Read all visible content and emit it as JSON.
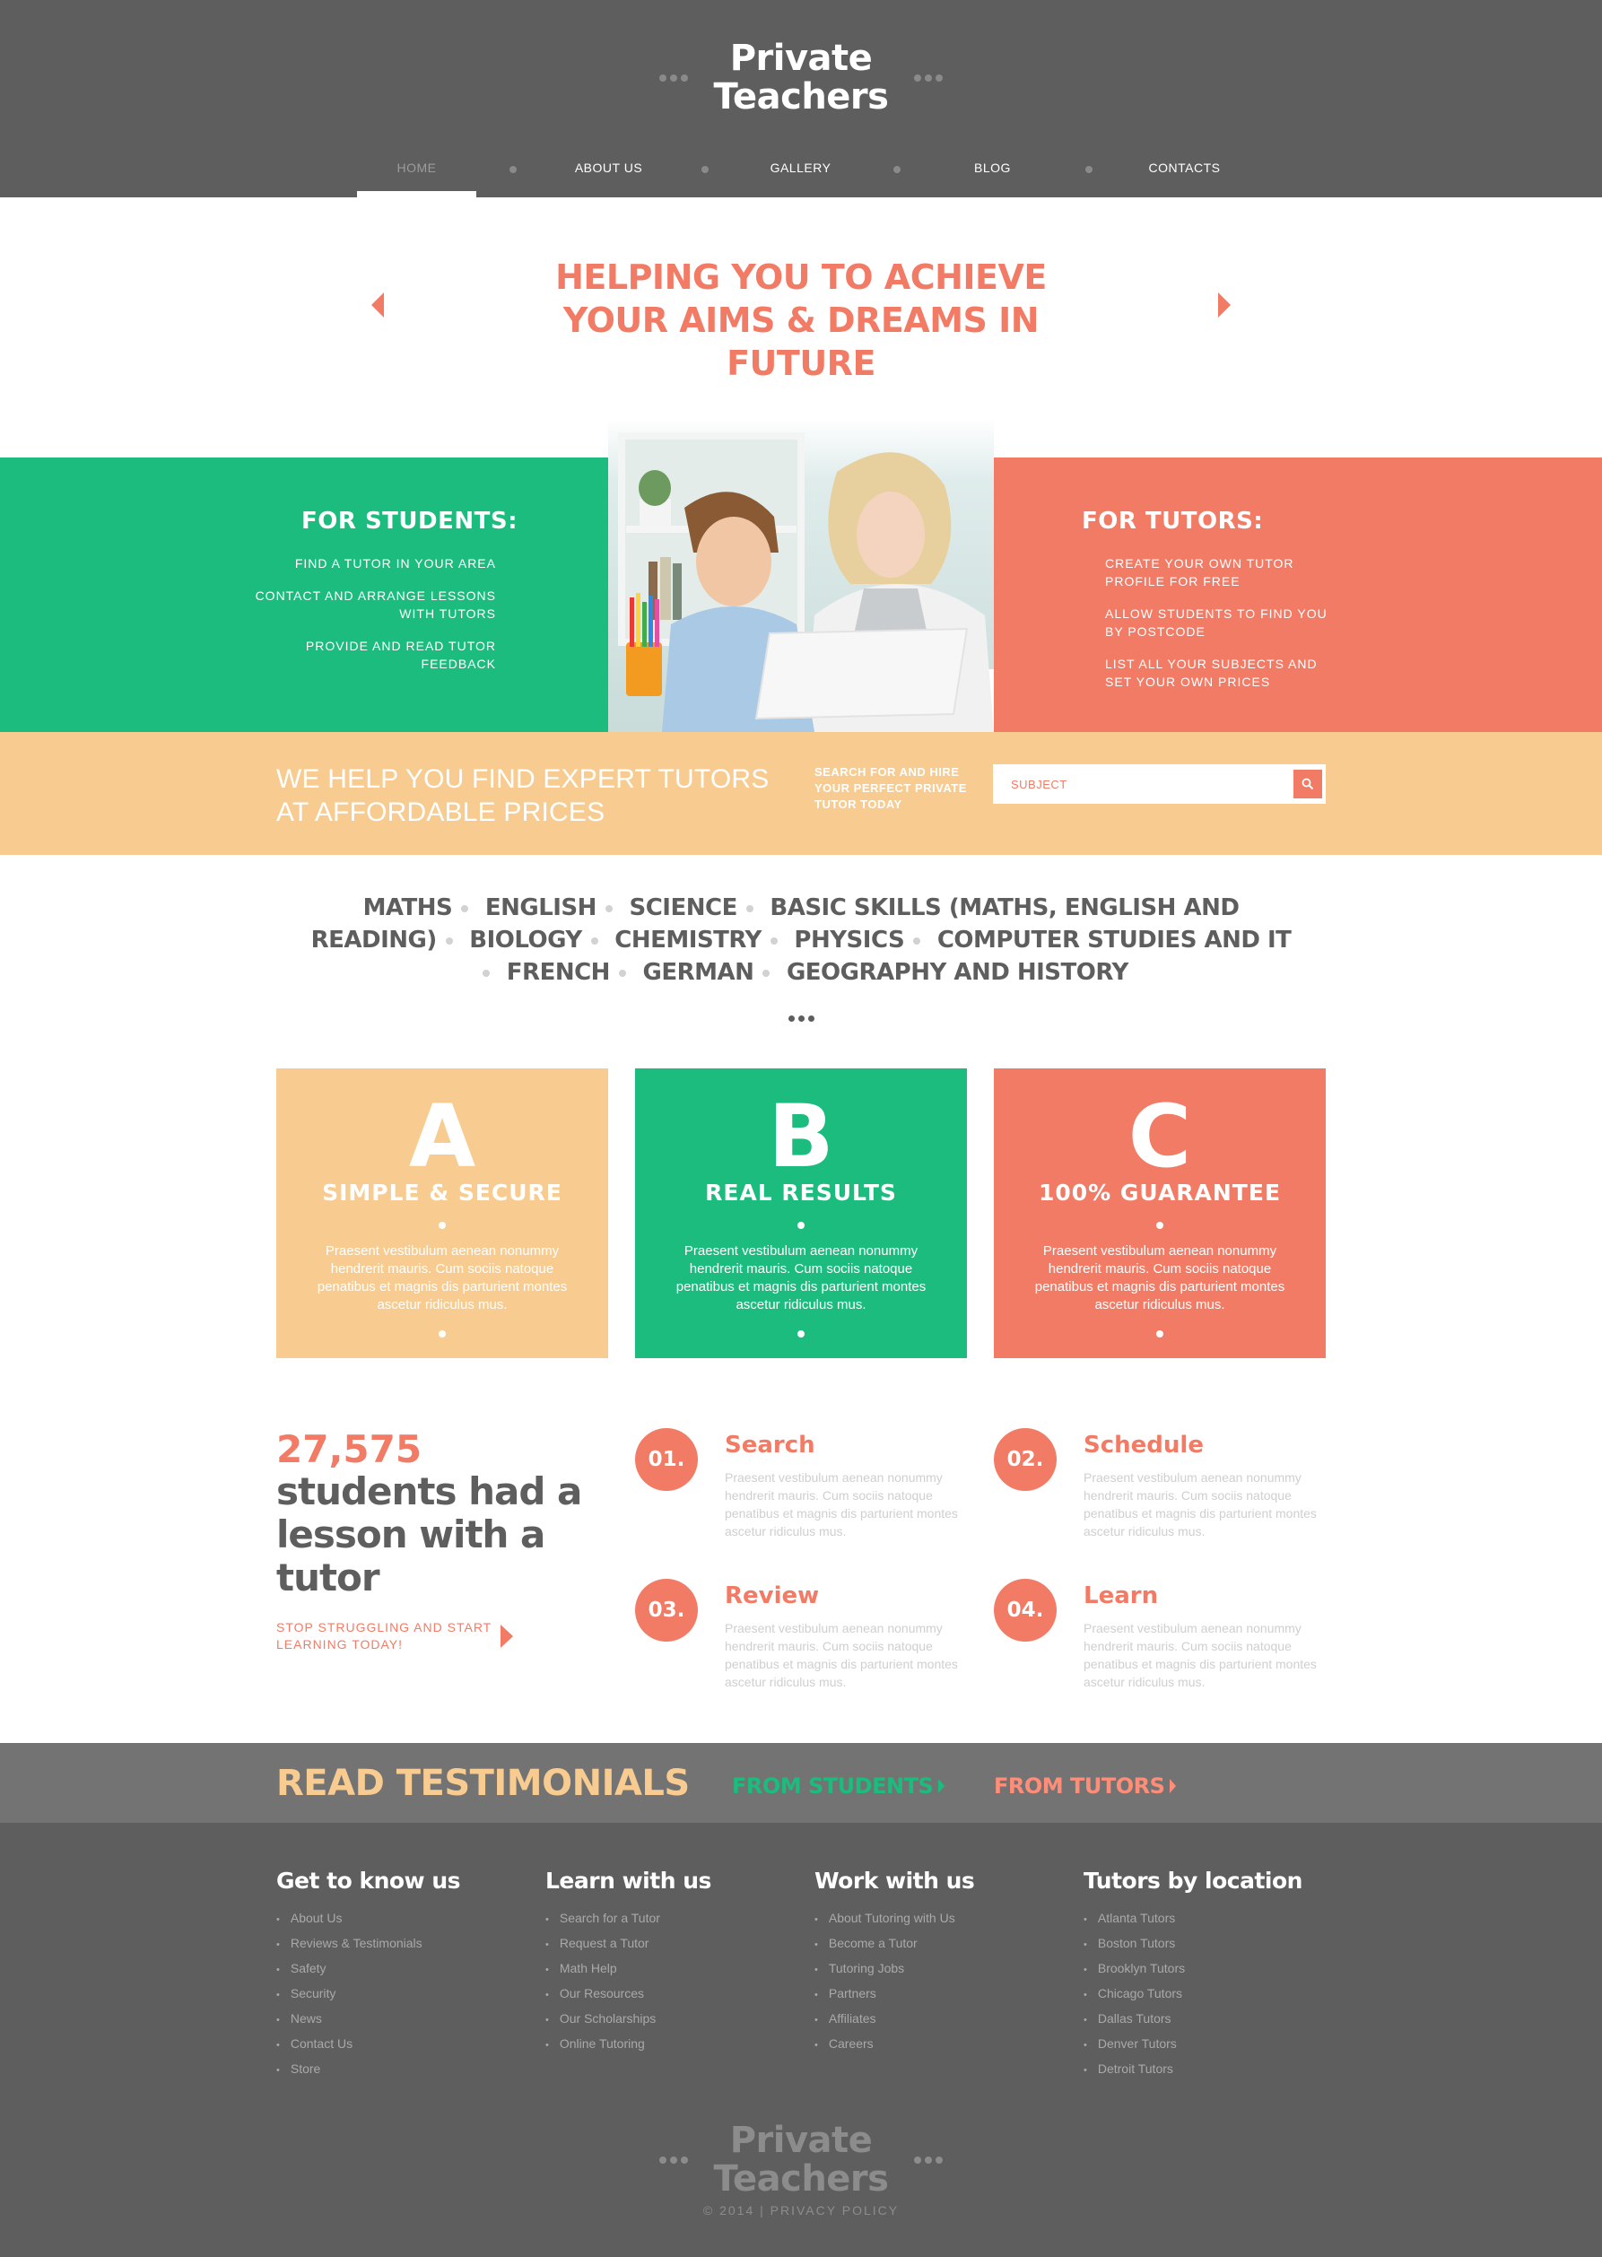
{
  "header": {
    "logo_line1": "Private",
    "logo_line2": "Teachers",
    "nav": [
      {
        "label": "HOME",
        "active": true
      },
      {
        "label": "ABOUT US"
      },
      {
        "label": "GALLERY"
      },
      {
        "label": "BLOG"
      },
      {
        "label": "CONTACTS"
      }
    ]
  },
  "hero": {
    "title": "HELPING YOU TO ACHIEVE YOUR AIMS & DREAMS IN FUTURE",
    "photo_alt": "Teacher and boy using a laptop",
    "students": {
      "title": "FOR STUDENTS:",
      "items": [
        "FIND A TUTOR IN YOUR AREA",
        "CONTACT AND ARRANGE LESSONS WITH TUTORS",
        "PROVIDE AND READ TUTOR FEEDBACK"
      ]
    },
    "tutors": {
      "title": "FOR TUTORS:",
      "items": [
        "CREATE YOUR OWN TUTOR PROFILE FOR FREE",
        "ALLOW STUDENTS TO FIND YOU BY POSTCODE",
        "LIST ALL YOUR SUBJECTS AND SET YOUR OWN PRICES"
      ]
    }
  },
  "search": {
    "headline": "WE HELP YOU FIND EXPERT TUTORS AT AFFORDABLE PRICES",
    "subtext": "SEARCH FOR AND HIRE YOUR PERFECT PRIVATE TUTOR TODAY",
    "placeholder": "SUBJECT",
    "value": ""
  },
  "subjects": [
    "MATHS",
    "ENGLISH",
    "SCIENCE",
    "BASIC SKILLS (MATHS, ENGLISH AND READING)",
    "BIOLOGY",
    "CHEMISTRY",
    "PHYSICS",
    "COMPUTER STUDIES AND IT",
    "FRENCH",
    "GERMAN",
    "GEOGRAPHY AND HISTORY"
  ],
  "cards": [
    {
      "letter": "A",
      "title": "SIMPLE & SECURE",
      "text": "Praesent vestibulum aenean nonummy hendrerit mauris. Cum sociis natoque penatibus et magnis dis parturient montes ascetur ridiculus mus."
    },
    {
      "letter": "B",
      "title": "REAL RESULTS",
      "text": "Praesent vestibulum aenean nonummy hendrerit mauris. Cum sociis natoque penatibus et magnis dis parturient montes ascetur ridiculus mus."
    },
    {
      "letter": "C",
      "title": "100% GUARANTEE",
      "text": "Praesent vestibulum aenean nonummy hendrerit mauris. Cum sociis natoque penatibus et magnis dis parturient montes ascetur ridiculus mus."
    }
  ],
  "stat": {
    "number": "27,575",
    "text": "students had a lesson with a tutor",
    "cta": "STOP STRUGGLING AND START LEARNING TODAY!"
  },
  "steps": [
    {
      "num": "01.",
      "title": "Search",
      "text": "Praesent vestibulum aenean nonummy hendrerit mauris. Cum sociis natoque penatibus et magnis dis parturient montes ascetur ridiculus mus."
    },
    {
      "num": "02.",
      "title": "Schedule",
      "text": "Praesent vestibulum aenean nonummy hendrerit mauris. Cum sociis natoque penatibus et magnis dis parturient montes ascetur ridiculus mus."
    },
    {
      "num": "03.",
      "title": "Review",
      "text": "Praesent vestibulum aenean nonummy hendrerit mauris. Cum sociis natoque penatibus et magnis dis parturient montes ascetur ridiculus mus."
    },
    {
      "num": "04.",
      "title": "Learn",
      "text": "Praesent vestibulum aenean nonummy hendrerit mauris. Cum sociis natoque penatibus et magnis dis parturient montes ascetur ridiculus mus."
    }
  ],
  "testimonials": {
    "title": "READ TESTIMONIALS",
    "from_students": "FROM STUDENTS",
    "from_tutors": "FROM TUTORS"
  },
  "footer": {
    "columns": [
      {
        "title": "Get to know us",
        "links": [
          "About Us",
          "Reviews & Testimonials",
          "Safety",
          "Security",
          "News",
          "Contact Us",
          "Store"
        ]
      },
      {
        "title": "Learn with us",
        "links": [
          "Search for a Tutor",
          "Request a Tutor",
          "Math Help",
          "Our Resources",
          "Our Scholarships",
          "Online Tutoring"
        ]
      },
      {
        "title": "Work with us",
        "links": [
          "About Tutoring with Us",
          "Become a Tutor",
          "Tutoring Jobs",
          "Partners",
          "Affiliates",
          "Careers"
        ]
      },
      {
        "title": "Tutors by location",
        "links": [
          "Atlanta Tutors",
          "Boston Tutors",
          "Brooklyn Tutors",
          "Chicago Tutors",
          "Dallas Tutors",
          "Denver Tutors",
          "Detroit Tutors"
        ]
      }
    ],
    "logo_line1": "Private",
    "logo_line2": "Teachers",
    "copyright": "© 2014",
    "separator": "|",
    "privacy": "PRIVACY POLICY"
  },
  "colors": {
    "green": "#1bbc7d",
    "coral": "#f27b66",
    "peach": "#f8cc90",
    "dark_gray": "#5e5e5e",
    "mid_gray": "#737373"
  }
}
